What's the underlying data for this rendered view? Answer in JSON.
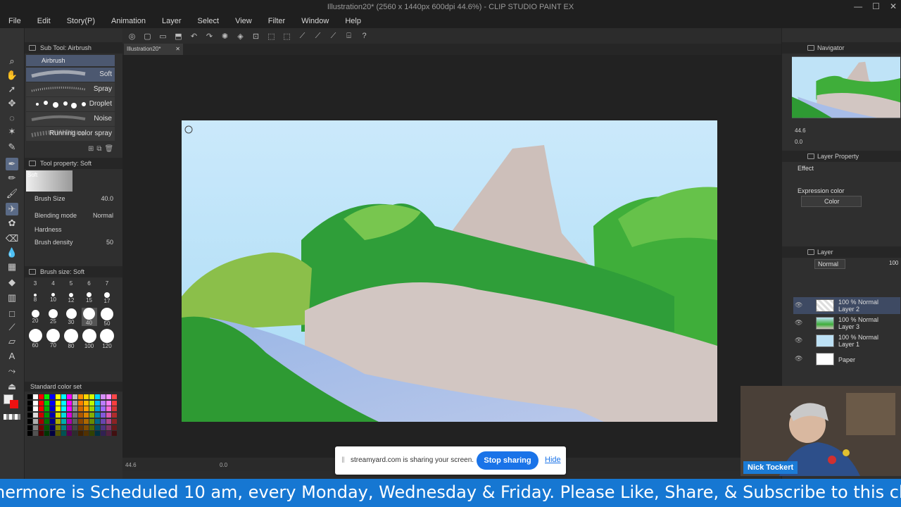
{
  "window": {
    "title": "Illustration20* (2560 x 1440px 600dpi 44.6%) - CLIP STUDIO PAINT EX",
    "controls": [
      "—",
      "☐",
      "✕"
    ]
  },
  "menu": [
    "File",
    "Edit",
    "Story(P)",
    "Animation",
    "Layer",
    "Select",
    "View",
    "Filter",
    "Window",
    "Help"
  ],
  "subtool": {
    "header": "Sub Tool: Airbrush",
    "group": "Airbrush",
    "items": [
      "Soft",
      "Spray",
      "Droplet",
      "Noise",
      "Running color spray"
    ],
    "selected": "Soft"
  },
  "tool_property": {
    "header": "Tool property: Soft",
    "preset": "Soft",
    "brush_size_label": "Brush Size",
    "brush_size": "40.0",
    "blending_label": "Blending mode",
    "blending": "Normal",
    "hardness_label": "Hardness",
    "density_label": "Brush density",
    "density": "50"
  },
  "brush_size_panel": {
    "header": "Brush size: Soft",
    "sizes": [
      "3",
      "4",
      "5",
      "6",
      "7",
      "8",
      "10",
      "12",
      "15",
      "17",
      "20",
      "25",
      "30",
      "40",
      "50",
      "60",
      "70",
      "80",
      "100",
      "120"
    ],
    "selected": "40"
  },
  "color_set": {
    "header": "Standard color set"
  },
  "document": {
    "tab": "Illustration20*",
    "zoom": "44.6",
    "rotation": "0.0"
  },
  "navigator": {
    "header": "Navigator",
    "zoom": "44.6",
    "rotation": "0.0"
  },
  "layer_property": {
    "header": "Layer Property",
    "effect_label": "Effect",
    "expression_label": "Expression color",
    "expression_value": "Color"
  },
  "layers": {
    "header": "Layer",
    "blend": "Normal",
    "opacity": "100",
    "items": [
      {
        "line1": "100 % Normal",
        "line2": "Layer 2",
        "selected": true
      },
      {
        "line1": "100 % Normal",
        "line2": "Layer 3",
        "selected": false
      },
      {
        "line1": "100 % Normal",
        "line2": "Layer 1",
        "selected": false
      },
      {
        "line1": "",
        "line2": "Paper",
        "selected": false
      }
    ]
  },
  "share": {
    "message": "streamyard.com is sharing your screen.",
    "stop": "Stop sharing",
    "hide": "Hide"
  },
  "stream": {
    "name": "Nick Tockert",
    "ticker": "hermore is Scheduled 10 am, every Monday, Wednesday & Friday. Please Like, Share, & Subscribe to this chan"
  },
  "colors": {
    "accent": "#1677d2",
    "sky": "#bfe3f7",
    "mountain": "#cdbfba",
    "foliage": "#3fae3a"
  }
}
